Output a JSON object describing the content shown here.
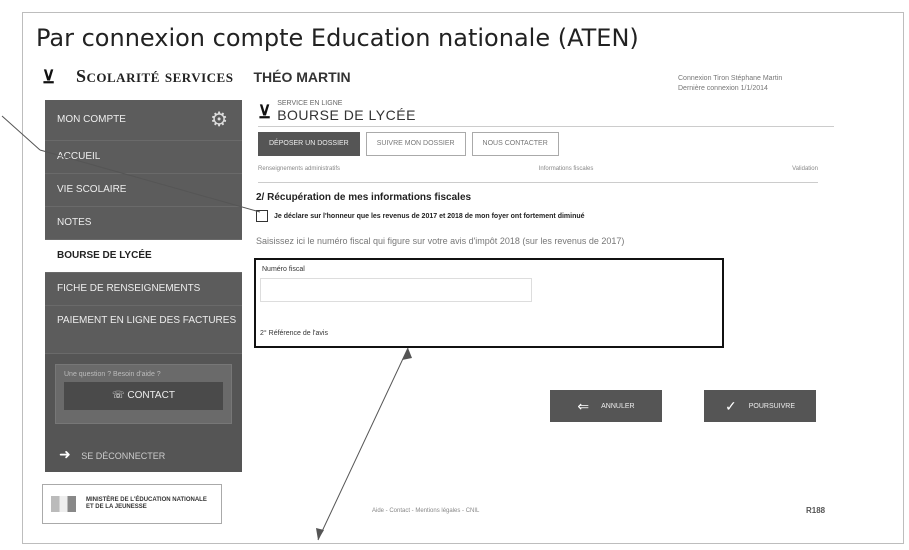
{
  "heading": "Par connexion compte Education nationale (ATEN)",
  "brand": {
    "name": "Scolarité services",
    "user": "THÉO MARTIN"
  },
  "top_right": {
    "line1": "Connexion Tiron Stéphane Martin",
    "line2": "Dernière connexion 1/1/2014"
  },
  "sidebar": {
    "items": [
      {
        "label": "MON COMPTE"
      },
      {
        "label": "ACCUEIL"
      },
      {
        "label": "VIE SCOLAIRE"
      },
      {
        "label": "NOTES"
      },
      {
        "label": "BOURSE DE LYCÉE"
      },
      {
        "label": "FICHE DE RENSEIGNEMENTS"
      },
      {
        "label": "PAIEMENT EN LIGNE DES FACTURES"
      }
    ],
    "contact_hint": "Une question ? Besoin d'aide ?",
    "contact_label": "CONTACT",
    "logout_label": "SE DÉCONNECTER"
  },
  "service": {
    "small": "SERVICE EN LIGNE",
    "title": "BOURSE DE LYCÉE"
  },
  "tabs": [
    {
      "label": "DÉPOSER UN DOSSIER"
    },
    {
      "label": "SUIVRE MON DOSSIER"
    },
    {
      "label": "NOUS CONTACTER"
    }
  ],
  "progress": [
    "Renseignements administratifs",
    "Informations fiscales",
    "Validation"
  ],
  "step_title": "2/ Récupération de mes informations fiscales",
  "checkbox_label": "Je déclare sur l'honneur que les revenus de 2017 et 2018 de mon foyer ont fortement diminué",
  "instruction": "Saisissez ici le numéro fiscal qui figure sur votre avis d'impôt 2018 (sur les revenus de 2017)",
  "form": {
    "field1_label": "Numéro fiscal",
    "field2_label": "2° Référence de l'avis"
  },
  "buttons": {
    "cancel": "ANNULER",
    "continue": "POURSUIVRE"
  },
  "footer": {
    "ministry": "Ministère de l'Éducation nationale et de la Jeunesse",
    "links": "Aide - Contact - Mentions légales - CNIL",
    "code": "R188"
  }
}
